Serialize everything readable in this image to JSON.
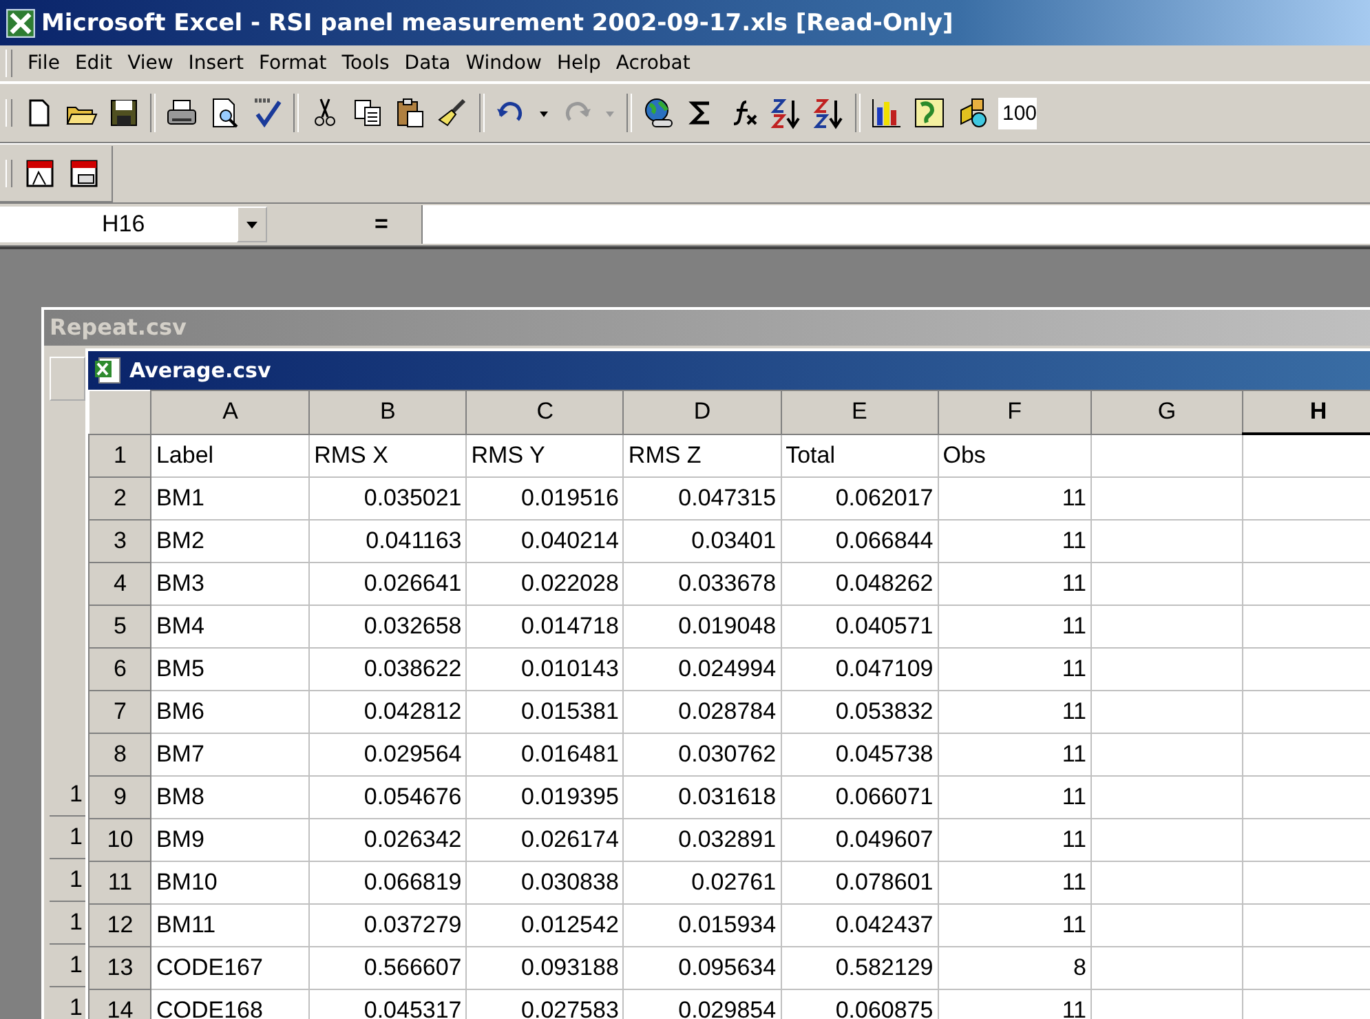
{
  "window": {
    "title": "Microsoft Excel - RSI panel measurement 2002-09-17.xls [Read-Only]"
  },
  "menu": [
    "File",
    "Edit",
    "View",
    "Insert",
    "Format",
    "Tools",
    "Data",
    "Window",
    "Help",
    "Acrobat"
  ],
  "toolbar": {
    "zoom": "100"
  },
  "formula_bar": {
    "name_box": "H16",
    "equals": "="
  },
  "back_window": {
    "title": "Repeat.csv",
    "row_header_fragments": [
      "1",
      "1",
      "1",
      "1",
      "1",
      "1"
    ]
  },
  "sheet_window": {
    "title": "Average.csv",
    "columns": [
      {
        "label": "A",
        "selected": false
      },
      {
        "label": "B",
        "selected": false
      },
      {
        "label": "C",
        "selected": false
      },
      {
        "label": "D",
        "selected": false
      },
      {
        "label": "E",
        "selected": false
      },
      {
        "label": "F",
        "selected": false
      },
      {
        "label": "G",
        "selected": false
      },
      {
        "label": "H",
        "selected": true
      }
    ],
    "rows": [
      {
        "header": "1",
        "cells": [
          "Label",
          "RMS X",
          "RMS Y",
          "RMS Z",
          "Total",
          "Obs"
        ]
      },
      {
        "header": "2",
        "cells": [
          "BM1",
          "0.035021",
          "0.019516",
          "0.047315",
          "0.062017",
          "11"
        ]
      },
      {
        "header": "3",
        "cells": [
          "BM2",
          "0.041163",
          "0.040214",
          "0.03401",
          "0.066844",
          "11"
        ]
      },
      {
        "header": "4",
        "cells": [
          "BM3",
          "0.026641",
          "0.022028",
          "0.033678",
          "0.048262",
          "11"
        ]
      },
      {
        "header": "5",
        "cells": [
          "BM4",
          "0.032658",
          "0.014718",
          "0.019048",
          "0.040571",
          "11"
        ]
      },
      {
        "header": "6",
        "cells": [
          "BM5",
          "0.038622",
          "0.010143",
          "0.024994",
          "0.047109",
          "11"
        ]
      },
      {
        "header": "7",
        "cells": [
          "BM6",
          "0.042812",
          "0.015381",
          "0.028784",
          "0.053832",
          "11"
        ]
      },
      {
        "header": "8",
        "cells": [
          "BM7",
          "0.029564",
          "0.016481",
          "0.030762",
          "0.045738",
          "11"
        ]
      },
      {
        "header": "9",
        "cells": [
          "BM8",
          "0.054676",
          "0.019395",
          "0.031618",
          "0.066071",
          "11"
        ]
      },
      {
        "header": "10",
        "cells": [
          "BM9",
          "0.026342",
          "0.026174",
          "0.032891",
          "0.049607",
          "11"
        ]
      },
      {
        "header": "11",
        "cells": [
          "BM10",
          "0.066819",
          "0.030838",
          "0.02761",
          "0.078601",
          "11"
        ]
      },
      {
        "header": "12",
        "cells": [
          "BM11",
          "0.037279",
          "0.012542",
          "0.015934",
          "0.042437",
          "11"
        ]
      },
      {
        "header": "13",
        "cells": [
          "CODE167",
          "0.566607",
          "0.093188",
          "0.095634",
          "0.582129",
          "8"
        ]
      },
      {
        "header": "14",
        "cells": [
          "CODE168",
          "0.045317",
          "0.027583",
          "0.029854",
          "0.060875",
          "11"
        ]
      }
    ]
  }
}
